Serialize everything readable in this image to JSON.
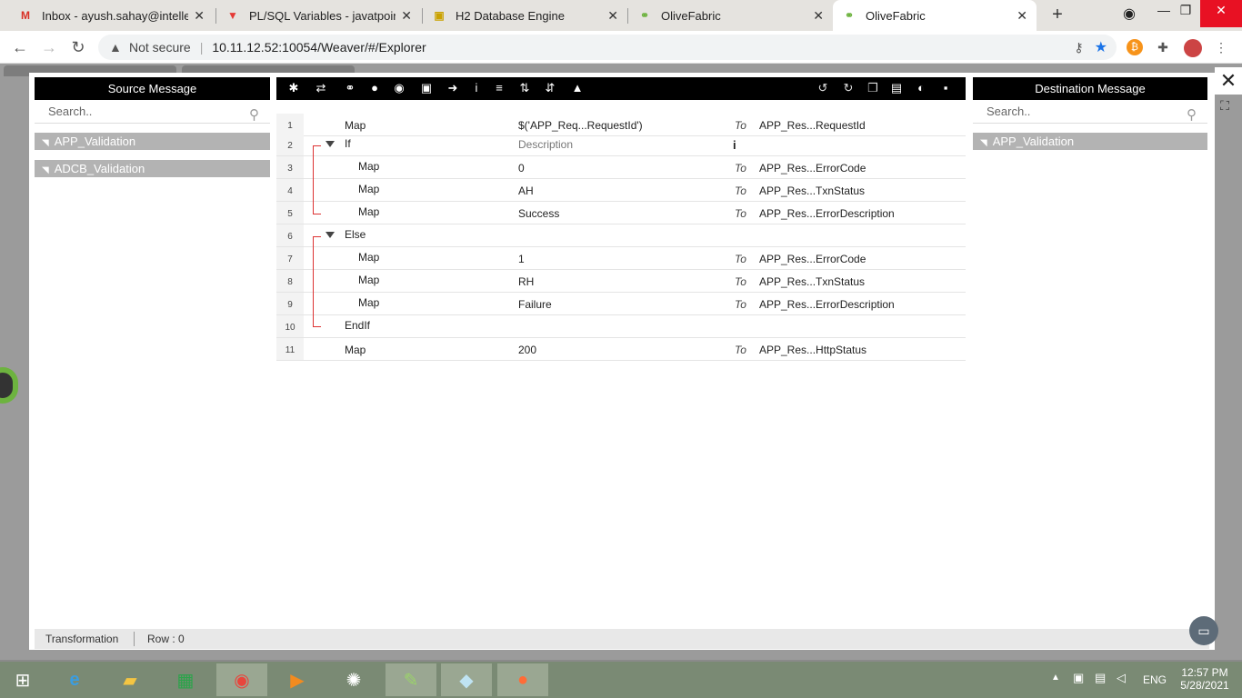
{
  "browser": {
    "tabs": [
      {
        "title": "Inbox - ayush.sahay@intellectd",
        "icon": "gmail-icon",
        "active": false
      },
      {
        "title": "PL/SQL Variables - javatpoint",
        "icon": "javatpoint-icon",
        "active": false
      },
      {
        "title": "H2 Database Engine",
        "icon": "h2-icon",
        "active": false
      },
      {
        "title": "OliveFabric",
        "icon": "olivefabric-icon",
        "active": false
      },
      {
        "title": "OliveFabric",
        "icon": "olivefabric-icon",
        "active": true
      }
    ],
    "security_label": "Not secure",
    "url": "10.11.12.52:10054/Weaver/#/Explorer"
  },
  "source_panel": {
    "title": "Source Message",
    "search_placeholder": "Search..",
    "items": [
      "APP_Validation",
      "ADCB_Validation"
    ]
  },
  "destination_panel": {
    "title": "Destination Message",
    "search_placeholder": "Search..",
    "items": [
      "APP_Validation"
    ]
  },
  "toolbar_icons": [
    "gear-icon",
    "loop-icon",
    "link-icon",
    "pin-icon",
    "circle-icon",
    "square-icon",
    "next-icon",
    "info-icon",
    "stack-icon",
    "sort-up-icon",
    "sort-down-icon",
    "warning-icon",
    "undo-icon",
    "redo-icon",
    "copy-icon",
    "clipboard-icon",
    "contrast-icon",
    "save-icon"
  ],
  "rows": [
    {
      "n": "1",
      "kw": "Map",
      "val": "$('APP_Req...RequestId')",
      "to": "To",
      "dst": "APP_Res...RequestId"
    },
    {
      "n": "2",
      "kw": "If",
      "val": "Description",
      "to": "",
      "dst": ""
    },
    {
      "n": "3",
      "kw": "Map",
      "val": "0",
      "to": "To",
      "dst": "APP_Res...ErrorCode"
    },
    {
      "n": "4",
      "kw": "Map",
      "val": "AH",
      "to": "To",
      "dst": "APP_Res...TxnStatus"
    },
    {
      "n": "5",
      "kw": "Map",
      "val": "Success",
      "to": "To",
      "dst": "APP_Res...ErrorDescription"
    },
    {
      "n": "6",
      "kw": "Else",
      "val": "",
      "to": "",
      "dst": ""
    },
    {
      "n": "7",
      "kw": "Map",
      "val": "1",
      "to": "To",
      "dst": "APP_Res...ErrorCode"
    },
    {
      "n": "8",
      "kw": "Map",
      "val": "RH",
      "to": "To",
      "dst": "APP_Res...TxnStatus"
    },
    {
      "n": "9",
      "kw": "Map",
      "val": "Failure",
      "to": "To",
      "dst": "APP_Res...ErrorDescription"
    },
    {
      "n": "10",
      "kw": "EndIf",
      "val": "",
      "to": "",
      "dst": ""
    },
    {
      "n": "11",
      "kw": "Map",
      "val": "200",
      "to": "To",
      "dst": "APP_Res...HttpStatus"
    }
  ],
  "status": {
    "left": "Transformation",
    "row": "Row : 0"
  },
  "tray": {
    "lang": "ENG",
    "time": "12:57 PM",
    "date": "5/28/2021"
  }
}
